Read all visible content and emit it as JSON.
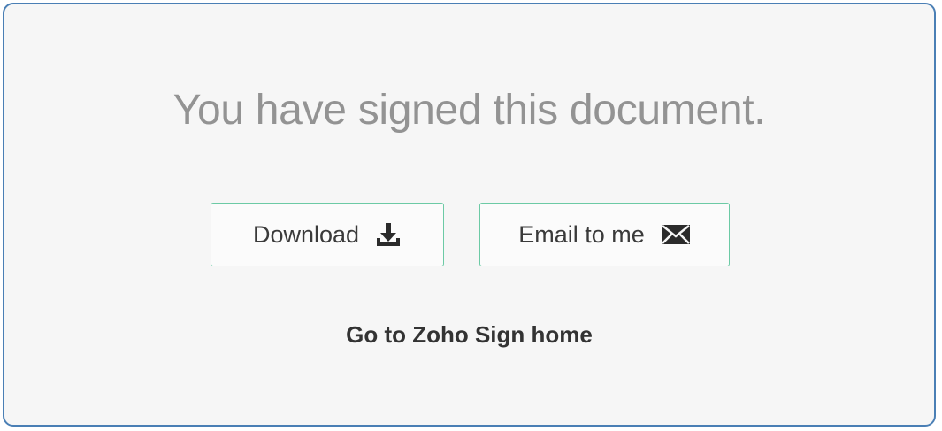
{
  "message": {
    "title": "You have signed this document."
  },
  "actions": {
    "download_label": "Download",
    "download_icon": "download-icon",
    "email_label": "Email to me",
    "email_icon": "envelope-icon"
  },
  "links": {
    "home_label": "Go to Zoho Sign home"
  },
  "colors": {
    "panel_border": "#4a7fb5",
    "button_border": "#6ccaa5",
    "title_text": "#939393",
    "body_text": "#333333"
  }
}
